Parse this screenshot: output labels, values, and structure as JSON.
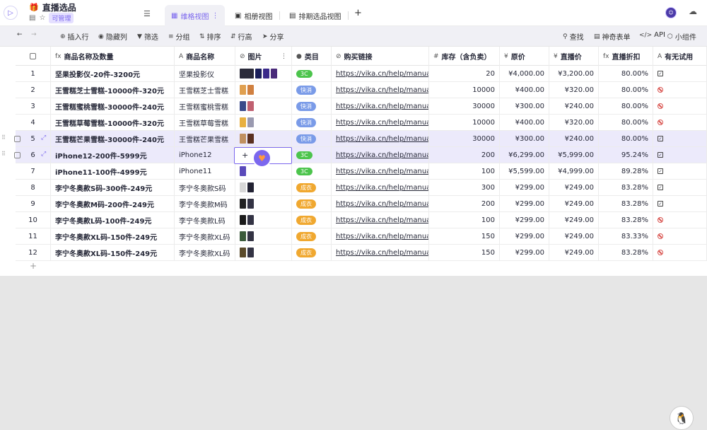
{
  "datasheet": {
    "title": "直播选品",
    "icon": "gift-icon",
    "permission_badge": "可管理"
  },
  "views": [
    {
      "label": "维格视图",
      "icon": "grid-view-icon",
      "active": true
    },
    {
      "label": "相册视图",
      "icon": "gallery-view-icon",
      "active": false
    },
    {
      "label": "排期选品视图",
      "icon": "gantt-view-icon",
      "active": false
    }
  ],
  "add_view": "+",
  "toolbar": {
    "insert_row": "插入行",
    "hide_columns": "隐藏列",
    "filter": "筛选",
    "group": "分组",
    "sort": "排序",
    "row_height": "行高",
    "share": "分享",
    "search": "查找",
    "form": "神奇表单",
    "api": "API",
    "widget": "小组件"
  },
  "columns": [
    {
      "name": "商品名称及数量",
      "icon": "formula-icon",
      "glyph": "fx"
    },
    {
      "name": "商品名称",
      "icon": "text-icon",
      "glyph": "A"
    },
    {
      "name": "图片",
      "icon": "attachment-icon",
      "glyph": "⊘"
    },
    {
      "name": "类目",
      "icon": "single-select-icon",
      "glyph": "●"
    },
    {
      "name": "购买链接",
      "icon": "link-icon",
      "glyph": "⊘"
    },
    {
      "name": "库存（含负卖）",
      "icon": "number-icon",
      "glyph": "#"
    },
    {
      "name": "原价",
      "icon": "currency-icon",
      "glyph": "¥"
    },
    {
      "name": "直播价",
      "icon": "currency-icon",
      "glyph": "¥"
    },
    {
      "name": "直播折扣",
      "icon": "formula-icon",
      "glyph": "fx"
    },
    {
      "name": "有无试用",
      "icon": "text-icon",
      "glyph": "A"
    }
  ],
  "rows": [
    {
      "no": "1",
      "title": "坚果投影仪-20件-3200元",
      "name": "坚果投影仪",
      "imgs": [
        "#2b2b3a",
        "#1a1f5a",
        "#3a2a8a",
        "#4a2b7a"
      ],
      "tag": "3C",
      "link": "https://vika.cn/help/manual/",
      "stock": "20",
      "price": "¥4,000.00",
      "live": "¥3,200.00",
      "disc": "80.00%",
      "trial": "yes"
    },
    {
      "no": "2",
      "title": "王雪糕芝士雪糕-10000件-320元",
      "name": "王雪糕芝士雪糕",
      "imgs": [
        "#e0a050",
        "#d08040"
      ],
      "tag": "快消",
      "link": "https://vika.cn/help/manual/",
      "stock": "10000",
      "price": "¥400.00",
      "live": "¥320.00",
      "disc": "80.00%",
      "trial": "no"
    },
    {
      "no": "3",
      "title": "王雪糕蜜桃雪糕-30000件-240元",
      "name": "王雪糕蜜桃雪糕",
      "imgs": [
        "#3a4a8a",
        "#c06070"
      ],
      "tag": "快消",
      "link": "https://vika.cn/help/manual/",
      "stock": "30000",
      "price": "¥300.00",
      "live": "¥240.00",
      "disc": "80.00%",
      "trial": "no"
    },
    {
      "no": "4",
      "title": "王雪糕草莓雪糕-10000件-320元",
      "name": "王雪糕草莓雪糕",
      "imgs": [
        "#e8b040",
        "#9a9ab0"
      ],
      "tag": "快消",
      "link": "https://vika.cn/help/manual/",
      "stock": "10000",
      "price": "¥400.00",
      "live": "¥320.00",
      "disc": "80.00%",
      "trial": "no"
    },
    {
      "no": "5",
      "title": "王雪糕芒果雪糕-30000件-240元",
      "name": "王雪糕芒果雪糕",
      "imgs": [
        "#c09060",
        "#5a3020"
      ],
      "tag": "快消",
      "link": "https://vika.cn/help/manual/",
      "stock": "30000",
      "price": "¥300.00",
      "live": "¥240.00",
      "disc": "80.00%",
      "trial": "yes"
    },
    {
      "no": "6",
      "title": "iPhone12-200件-5999元",
      "name": "iPhone12",
      "imgs": [
        "#6a5aaa",
        "#2a2a3a"
      ],
      "tag": "3C",
      "link": "https://vika.cn/help/manual/",
      "stock": "200",
      "price": "¥6,299.00",
      "live": "¥5,999.00",
      "disc": "95.24%",
      "trial": "yes"
    },
    {
      "no": "7",
      "title": "iPhone11-100件-4999元",
      "name": "iPhone11",
      "imgs": [
        "#5a4aba"
      ],
      "tag": "3C",
      "link": "https://vika.cn/help/manual/",
      "stock": "100",
      "price": "¥5,599.00",
      "live": "¥4,999.00",
      "disc": "89.28%",
      "trial": "yes"
    },
    {
      "no": "8",
      "title": "李宁冬奥款S码-300件-249元",
      "name": "李宁冬奥款S码",
      "imgs": [
        "#d8d8d8",
        "#222233"
      ],
      "tag": "成衣",
      "link": "https://vika.cn/help/manual/",
      "stock": "300",
      "price": "¥299.00",
      "live": "¥249.00",
      "disc": "83.28%",
      "trial": "yes"
    },
    {
      "no": "9",
      "title": "李宁冬奥款M码-200件-249元",
      "name": "李宁冬奥款M码",
      "imgs": [
        "#222222",
        "#333344"
      ],
      "tag": "成衣",
      "link": "https://vika.cn/help/manual/",
      "stock": "200",
      "price": "¥299.00",
      "live": "¥249.00",
      "disc": "83.28%",
      "trial": "yes"
    },
    {
      "no": "10",
      "title": "李宁冬奥款L码-100件-249元",
      "name": "李宁冬奥款L码",
      "imgs": [
        "#1a1a1a",
        "#333344"
      ],
      "tag": "成衣",
      "link": "https://vika.cn/help/manual/",
      "stock": "100",
      "price": "¥299.00",
      "live": "¥249.00",
      "disc": "83.28%",
      "trial": "no"
    },
    {
      "no": "11",
      "title": "李宁冬奥款XL码-150件-249元",
      "name": "李宁冬奥款XL码",
      "imgs": [
        "#3a5a3a",
        "#333344"
      ],
      "tag": "成衣",
      "link": "https://vika.cn/help/manual/",
      "stock": "150",
      "price": "¥299.00",
      "live": "¥249.00",
      "disc": "83.33%",
      "trial": "no"
    },
    {
      "no": "12",
      "title": "李宁冬奥款XL码-150件-249元",
      "name": "李宁冬奥款XL码",
      "imgs": [
        "#5a4a2a",
        "#333344"
      ],
      "tag": "成衣",
      "link": "https://vika.cn/help/manual/",
      "stock": "150",
      "price": "¥299.00",
      "live": "¥249.00",
      "disc": "83.28%",
      "trial": "no"
    }
  ],
  "tag_colors": {
    "3C": "#4cc44c",
    "快消": "#7a9be8",
    "成衣": "#f0a830"
  },
  "highlighted_rows": [
    "5",
    "6"
  ],
  "add_record": "+"
}
